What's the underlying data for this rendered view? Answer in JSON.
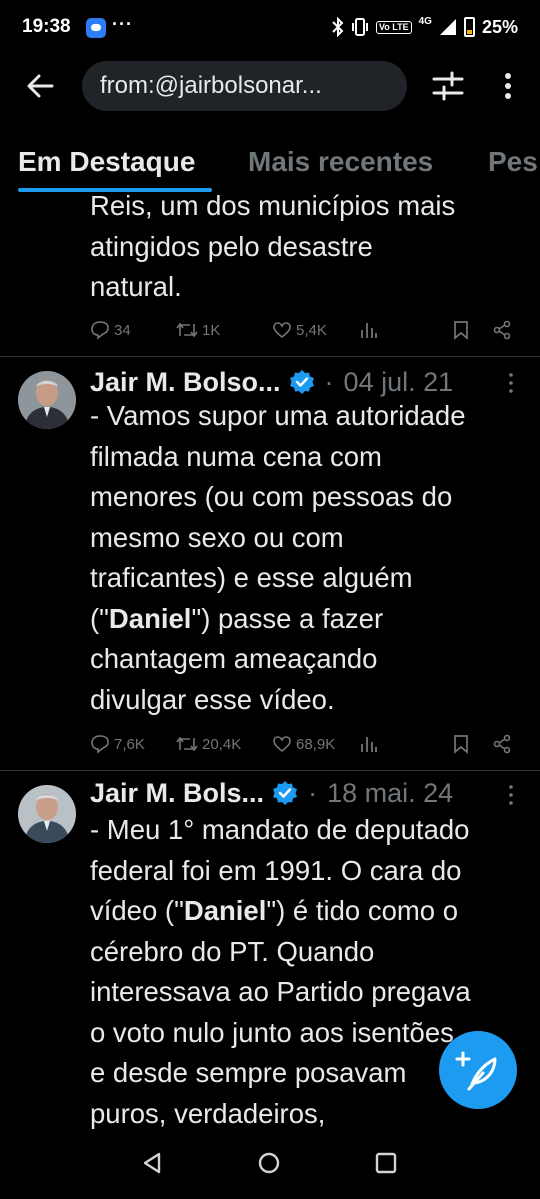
{
  "status_bar": {
    "time": "19:38",
    "dots": "···",
    "volte": "Vo LTE",
    "network": "4G",
    "battery": "25%"
  },
  "search": {
    "query": "from:@jairbolsonar..."
  },
  "tabs": [
    {
      "label": "Em Destaque"
    },
    {
      "label": "Mais recentes"
    },
    {
      "label": "Pes"
    }
  ],
  "tweets": [
    {
      "lines": [
        "Reis, um dos municípios mais",
        "atingidos pelo desastre",
        "natural."
      ],
      "replies": "34",
      "retweets": "1K",
      "likes": "5,4K"
    },
    {
      "author": "Jair M. Bolso...",
      "separator": "·",
      "date": "04 jul. 21",
      "lines": [
        "- Vamos supor uma autoridade",
        "filmada numa cena com",
        "menores (ou com pessoas do",
        "mesmo sexo ou com",
        "traficantes) e esse alguém"
      ],
      "line6_pre": "(\"",
      "line6_bold": "Daniel",
      "line6_post": "\") passe a fazer",
      "lines_after": [
        "chantagem ameaçando",
        "divulgar esse vídeo."
      ],
      "replies": "7,6K",
      "retweets": "20,4K",
      "likes": "68,9K"
    },
    {
      "author": "Jair M. Bols...",
      "separator": "·",
      "date": "18 mai. 24",
      "lines": [
        "- Meu 1° mandato de deputado",
        "federal foi em 1991. O cara do"
      ],
      "line3_pre": "vídeo (\"",
      "line3_bold": "Daniel",
      "line3_post": "\") é tido como o",
      "lines_after": [
        "cérebro do PT. Quando",
        "interessava ao Partido pregava",
        "o voto nulo junto aos isentões",
        "e desde sempre posavam",
        "puros, verdadeiros,"
      ]
    }
  ],
  "colors": {
    "accent": "#1d9bf0",
    "muted": "#71767b",
    "text": "#e7e9ea",
    "background": "#000000",
    "divider": "#2f3336"
  }
}
